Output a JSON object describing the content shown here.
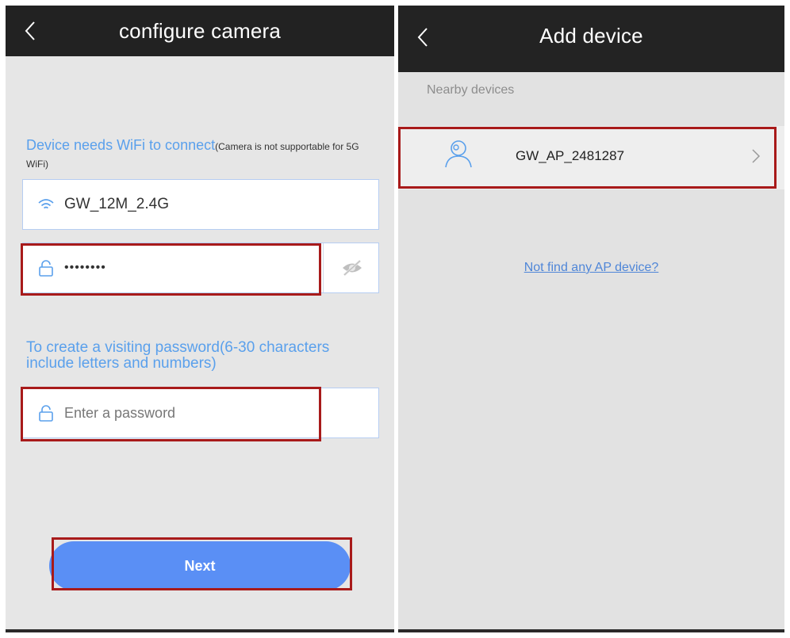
{
  "left": {
    "title": "configure camera",
    "wifi_hint": "Device needs WiFi to connect",
    "wifi_note": "(Camera is not supportable for 5G WiFi)",
    "ssid": "GW_12M_2.4G",
    "wifi_password": "••••••••",
    "visit_hint": "To create a visiting password(6-30 characters include letters and numbers)",
    "visit_placeholder": "Enter a password",
    "next_label": "Next"
  },
  "right": {
    "title": "Add device",
    "section_label": "Nearby devices",
    "device_name": "GW_AP_2481287",
    "not_find_link": "Not find any AP device?"
  },
  "colors": {
    "header": "#222222",
    "accent_text": "#5aa0ec",
    "button": "#5a8ff5",
    "highlight_box": "#a81a1a",
    "link": "#4f86d8"
  },
  "icons": [
    "back-chevron-icon",
    "wifi-icon",
    "lock-icon",
    "eye-hidden-icon",
    "user-icon",
    "chevron-right-icon"
  ]
}
